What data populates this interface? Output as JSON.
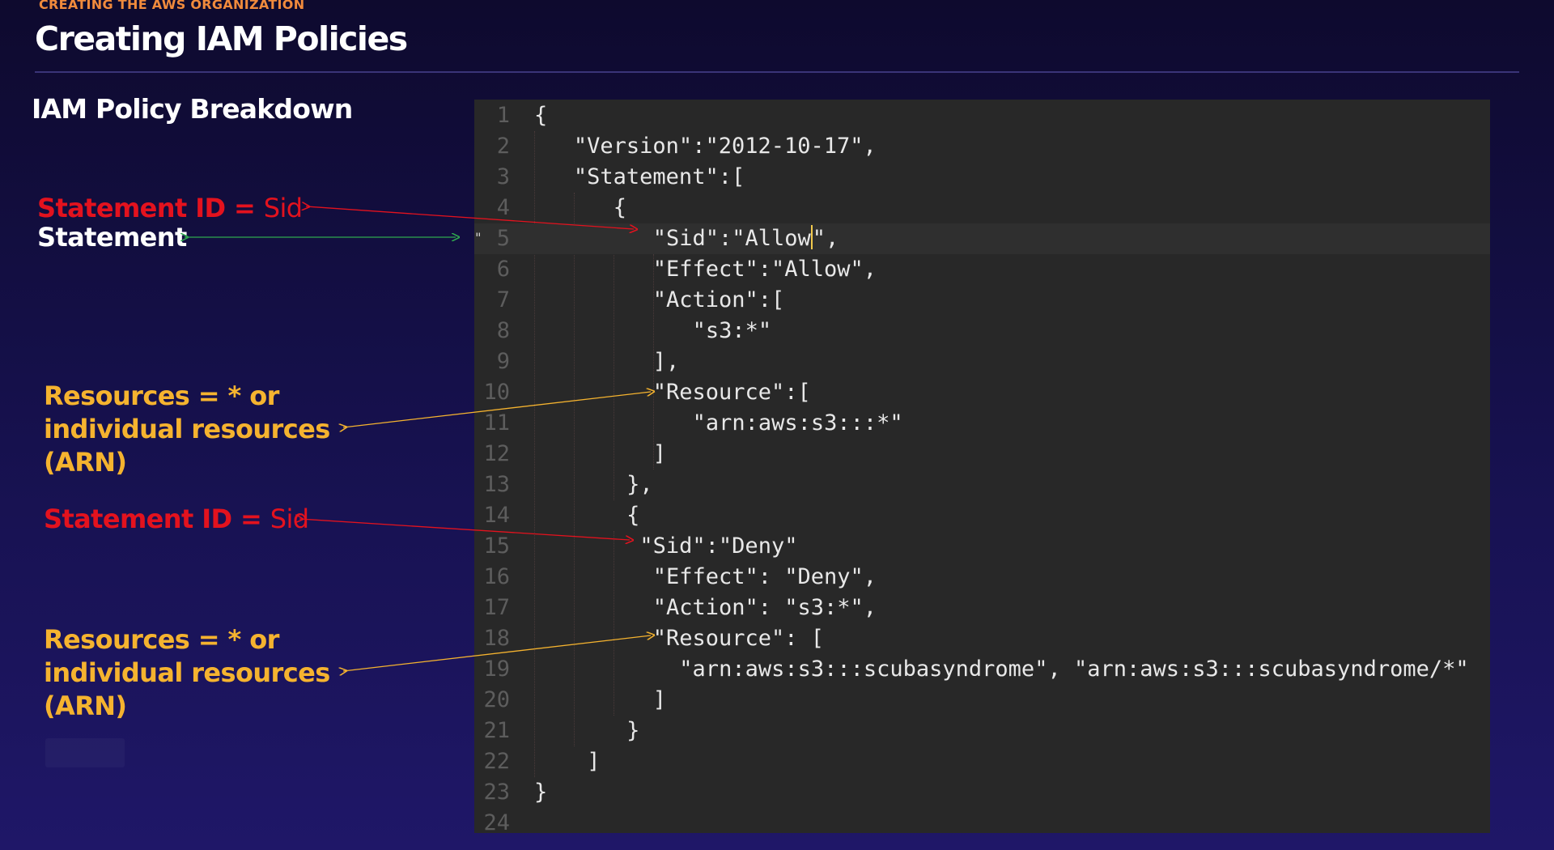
{
  "slide": {
    "kicker": "CREATING THE AWS ORGANIZATION",
    "title": "Creating IAM Policies",
    "subtitle": "IAM Policy Breakdown"
  },
  "annotations": {
    "sid1": {
      "label": "Statement ID = ",
      "value": "Sid"
    },
    "statement": {
      "label": "Statement"
    },
    "resources1": {
      "line1": "Resources = * or",
      "line2": "individual resources",
      "line3": "(ARN)"
    },
    "sid2": {
      "label": "Statement ID = ",
      "value": "Sid"
    },
    "resources2": {
      "line1": "Resources = * or",
      "line2": "individual resources",
      "line3": "(ARN)"
    }
  },
  "colors": {
    "kicker": "#f08a3c",
    "red_annotation": "#e3121e",
    "yellow_annotation": "#f5b32f",
    "statement_arrow": "#2fa84f",
    "editor_bg": "#282828"
  },
  "editor": {
    "active_line": 5,
    "gutter_marker": "\"",
    "lines": [
      {
        "n": "1",
        "text": "{"
      },
      {
        "n": "2",
        "text": "\"Version\":\"2012-10-17\","
      },
      {
        "n": "3",
        "text": "\"Statement\":["
      },
      {
        "n": "4",
        "text": "{"
      },
      {
        "n": "5",
        "text_before_cursor": "\"Sid\":\"Allow",
        "text_after_cursor": "\","
      },
      {
        "n": "6",
        "text": "\"Effect\":\"Allow\","
      },
      {
        "n": "7",
        "text": "\"Action\":["
      },
      {
        "n": "8",
        "text": "\"s3:*\""
      },
      {
        "n": "9",
        "text": "],"
      },
      {
        "n": "10",
        "text": "\"Resource\":["
      },
      {
        "n": "11",
        "text": "\"arn:aws:s3:::*\""
      },
      {
        "n": "12",
        "text": "]"
      },
      {
        "n": "13",
        "text": "},"
      },
      {
        "n": "14",
        "text": "{"
      },
      {
        "n": "15",
        "text": "\"Sid\":\"Deny\""
      },
      {
        "n": "16",
        "text": "\"Effect\": \"Deny\","
      },
      {
        "n": "17",
        "text": "\"Action\": \"s3:*\","
      },
      {
        "n": "18",
        "text": "\"Resource\": ["
      },
      {
        "n": "19",
        "text": "\"arn:aws:s3:::scubasyndrome\", \"arn:aws:s3:::scubasyndrome/*\""
      },
      {
        "n": "20",
        "text": "]"
      },
      {
        "n": "21",
        "text": "}"
      },
      {
        "n": "22",
        "text": "]"
      },
      {
        "n": "23",
        "text": "}"
      },
      {
        "n": "24",
        "text": ""
      }
    ]
  }
}
